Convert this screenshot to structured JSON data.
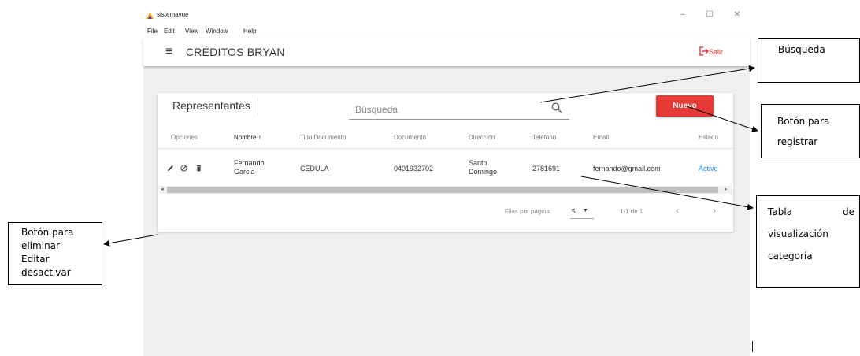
{
  "window": {
    "app_name": "sistemavue",
    "minimize": "–",
    "maximize": "☐",
    "close": "✕"
  },
  "menu": [
    "File",
    "Edit",
    "View",
    "Window",
    "Help"
  ],
  "appbar": {
    "title": "CRÉDITOS BRYAN",
    "logout_label": "Salir",
    "menu_icon": "hamburger-icon"
  },
  "card": {
    "title": "Representantes",
    "search_placeholder": "Búsqueda",
    "new_button": "Nuevo"
  },
  "table": {
    "headers": [
      "Opciones",
      "Nombre",
      "Tipo Documento",
      "Documento",
      "Dirección",
      "Teléfono",
      "Email",
      "Estado"
    ],
    "sort_indicator": "↑",
    "rows": [
      {
        "nombre": "Fernando Garcia",
        "tipo_documento": "CEDULA",
        "documento": "0401932702",
        "direccion": "Santo Domingo",
        "telefono": "2781691",
        "email": "fernando@gmail.com",
        "estado": "Activo",
        "actions": [
          "edit-icon",
          "deactivate-icon",
          "delete-icon"
        ]
      }
    ],
    "footer": {
      "rows_per_page_label": "Filas por página:",
      "rows_per_page_value": "5",
      "range": "1-1 de 1",
      "prev": "‹",
      "next": "›"
    }
  },
  "annotations": {
    "busqueda": "Búsqueda",
    "boton_registrar_1": "Botón para",
    "boton_registrar_2": "registrar",
    "boton_acciones_1": "Botón para",
    "boton_acciones_2": "eliminar",
    "boton_acciones_3": "Editar",
    "boton_acciones_4": "desactivar",
    "tabla_1a": "Tabla",
    "tabla_1b": "de",
    "tabla_2": "visualización",
    "tabla_3": "categoría"
  },
  "colors": {
    "accent_red": "#e53935",
    "active_blue": "#1e88e5",
    "window_bg": "#f1efed"
  }
}
